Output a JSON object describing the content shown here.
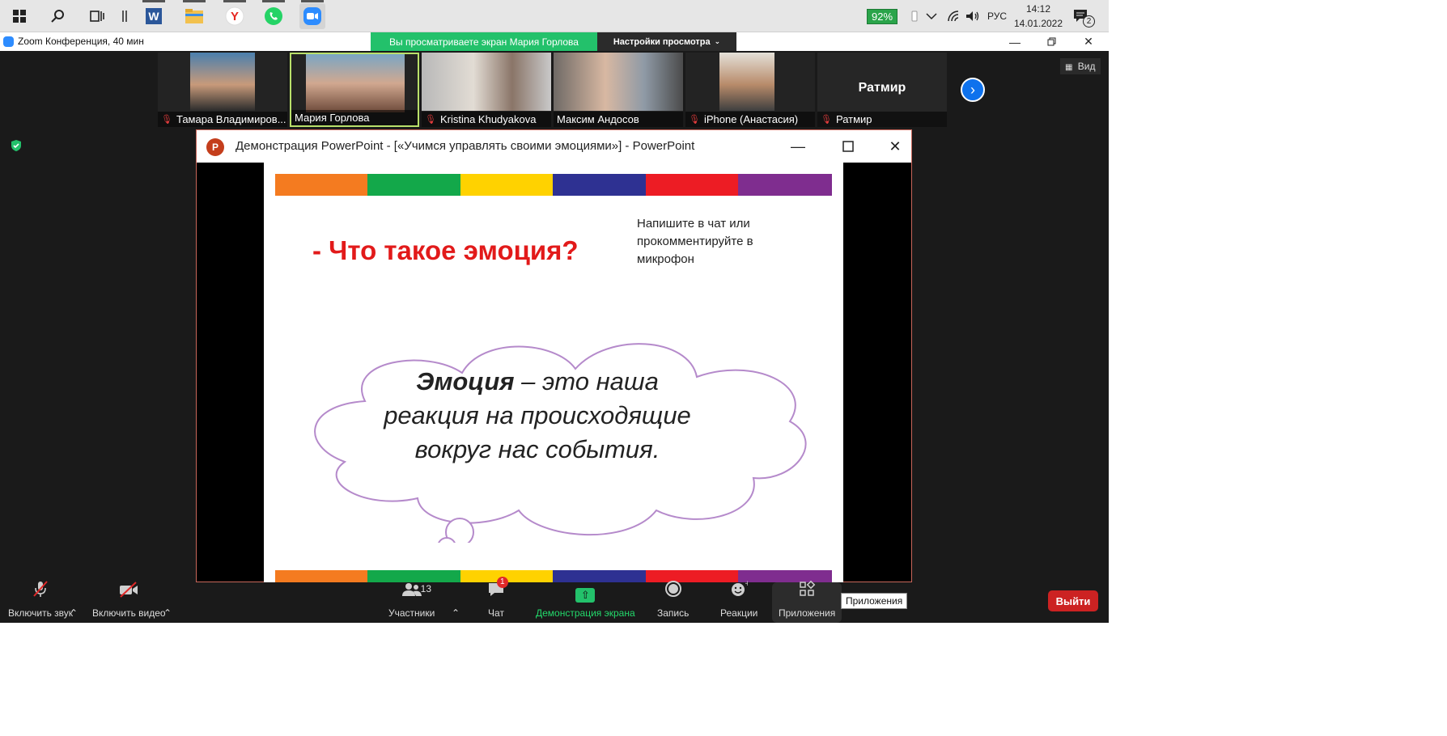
{
  "taskbar": {
    "battery": "92%",
    "language": "РУС",
    "time": "14:12",
    "date": "14.01.2022",
    "notification_count": "2",
    "icons": [
      "windows-start-icon",
      "search-icon",
      "task-view-icon",
      "word-icon",
      "file-explorer-icon",
      "yandex-browser-icon",
      "whatsapp-icon",
      "zoom-icon"
    ]
  },
  "zoom": {
    "title": "Zoom Конференция, 40 мин",
    "viewing_banner": "Вы просматриваете экран Мария Горлова",
    "view_settings": "Настройки просмотра",
    "view_button": "Вид"
  },
  "participants": [
    {
      "name": "Тамара Владимиров...",
      "muted": true
    },
    {
      "name": "Мария Горлова",
      "muted": false,
      "speaking": true
    },
    {
      "name": "Kristina Khudyakova",
      "muted": true
    },
    {
      "name": "Максим Андосов",
      "muted": false
    },
    {
      "name": "iPhone (Анастасия)",
      "muted": true
    },
    {
      "name": "Ратмир",
      "muted": true,
      "video": false
    }
  ],
  "ppt": {
    "title": "Демонстрация PowerPoint - [«Учимся управлять своими эмоциями»] - PowerPoint",
    "logo": "P",
    "stripe_colors": [
      "#f47b20",
      "#13a84a",
      "#ffd200",
      "#2e3192",
      "#ed1c24",
      "#7f2d8f"
    ],
    "heading": "- Что такое эмоция?",
    "hint": "Напишите в чат или прокомментируйте в микрофон",
    "cloud_term": "Эмоция",
    "cloud_dash": " –  это наша",
    "cloud_line2": "реакция на происходящие",
    "cloud_line3": "вокруг нас события."
  },
  "toolbar": {
    "audio": "Включить звук",
    "video": "Включить видео",
    "participants": "Участники",
    "participants_count": "13",
    "chat": "Чат",
    "chat_badge": "1",
    "share": "Демонстрация экрана",
    "record": "Запись",
    "reactions": "Реакции",
    "apps": "Приложения",
    "apps_tooltip": "Приложения",
    "leave": "Выйти"
  },
  "colors": {
    "accent_green": "#23c16b",
    "leave_red": "#cc2222",
    "zoom_blue": "#0e72ed",
    "heading_red": "#e21a1a",
    "cloud_outline": "#b58acb"
  }
}
